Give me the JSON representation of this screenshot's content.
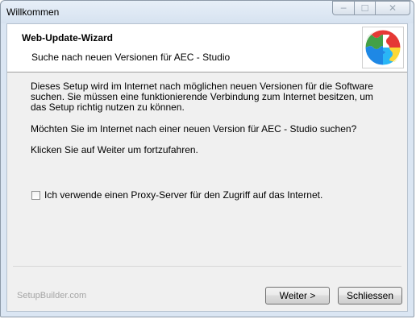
{
  "window": {
    "title": "Willkommen",
    "caption": {
      "minimize": "─",
      "maximize": "☐",
      "close": "✕"
    }
  },
  "header": {
    "title": "Web-Update-Wizard",
    "subtitle": "Suche nach neuen Versionen für AEC - Studio",
    "logo_icon": "puzzle-globe-icon"
  },
  "body": {
    "paragraph1": "Dieses Setup wird im Internet nach möglichen neuen Versionen für die Software suchen. Sie müssen eine funktionierende Verbindung zum Internet besitzen, um das Setup richtig nutzen zu können.",
    "paragraph2": "Möchten Sie im Internet nach einer neuen Version für AEC - Studio suchen?",
    "paragraph3": "Klicken Sie auf Weiter um fortzufahren.",
    "proxy_checkbox": {
      "label": "Ich verwende einen Proxy-Server für den Zugriff auf das Internet.",
      "checked": false
    }
  },
  "footer": {
    "brand": "SetupBuilder.com",
    "next_label": "Weiter >",
    "close_label": "Schliessen"
  },
  "colors": {
    "frame": "#dbe6f3",
    "client": "#f0f0f0",
    "header": "#ffffff",
    "brand_text": "#a5a5a5"
  }
}
